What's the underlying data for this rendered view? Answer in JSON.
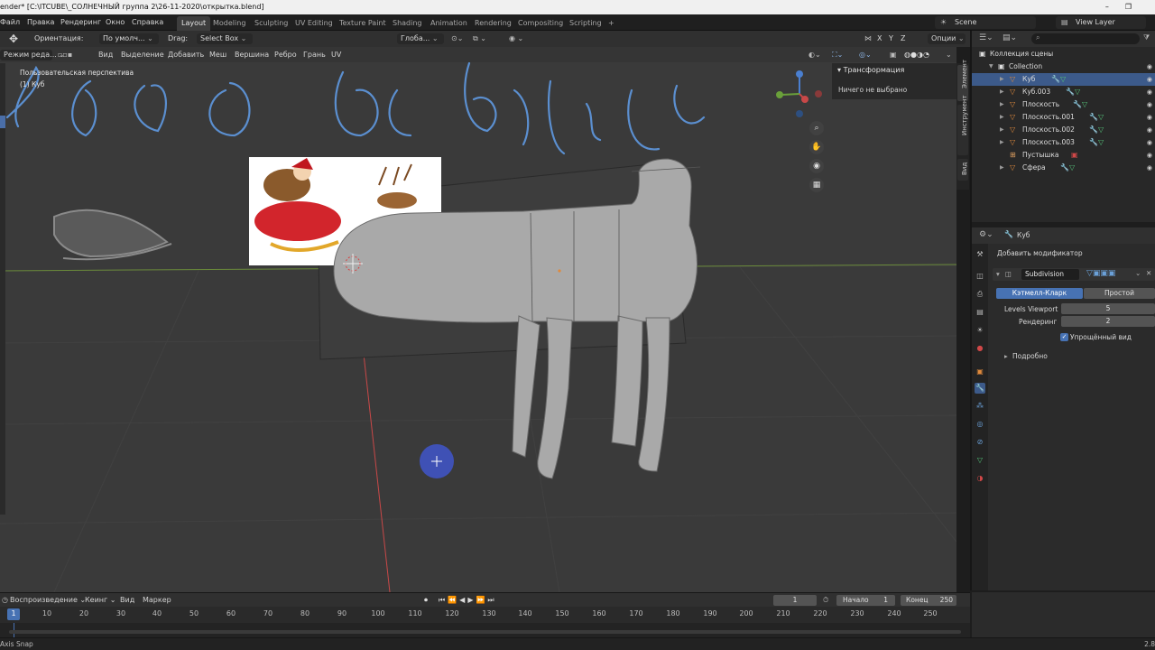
{
  "window": {
    "title": "ender* [C:\\ITCUBE\\_СОЛНЕЧНЫЙ группа 2\\26-11-2020\\открытка.blend]",
    "restore_icon": "restore-icon"
  },
  "menubar": {
    "menus": [
      "Файл",
      "Правка",
      "Рендеринг",
      "Окно",
      "Справка"
    ],
    "workspaces": [
      "Layout",
      "Modeling",
      "Sculpting",
      "UV Editing",
      "Texture Paint",
      "Shading",
      "Animation",
      "Rendering",
      "Compositing",
      "Scripting"
    ],
    "active_workspace": "Layout",
    "add_tab": "+",
    "scene": "Scene",
    "view_layer": "View Layer"
  },
  "tool_header": {
    "orientation_label": "Ориентация:",
    "orientation_value": "По умолч...",
    "drag_label": "Drag:",
    "drag_value": "Select Box",
    "transform_value": "Глоба...",
    "axes": [
      "X",
      "Y",
      "Z"
    ],
    "options": "Опции"
  },
  "viewport_header": {
    "mode": "Режим реда...",
    "menus": [
      "Вид",
      "Выделение",
      "Добавить",
      "Меш",
      "Вершина",
      "Ребро",
      "Грань",
      "UV"
    ]
  },
  "viewport": {
    "perspective": "Пользовательская перспектива",
    "object": "(1) Куб",
    "handwriting": "Ξ ǝǝɡ ǝo ǝκςrpt",
    "colors": {
      "background": "#3a3a3a",
      "mesh": "#a9a9a9",
      "handwriting": "#5b8fd0",
      "cursor_circle": "#3f51b5",
      "x_axis": "#c84848"
    }
  },
  "n_panel": {
    "header": "Трансформация",
    "message": "Ничего не выбрано",
    "tabs": [
      "Элемент",
      "Инструмент",
      "Вид"
    ]
  },
  "outliner": {
    "header": "Коллекция сцены",
    "collection": "Collection",
    "items": [
      {
        "name": "Куб",
        "selected": true
      },
      {
        "name": "Куб.003",
        "selected": false
      },
      {
        "name": "Плоскость",
        "selected": false
      },
      {
        "name": "Плоскость.001",
        "selected": false
      },
      {
        "name": "Плоскость.002",
        "selected": false
      },
      {
        "name": "Плоскость.003",
        "selected": false
      },
      {
        "name": "Пустышка",
        "selected": false
      },
      {
        "name": "Сфера",
        "selected": false
      }
    ]
  },
  "properties": {
    "object": "Куб",
    "add_modifier": "Добавить модификатор",
    "modifier_name": "Subdivision",
    "mode_catmull": "Кэтмелл-Кларк",
    "mode_simple": "Простой",
    "levels_viewport_label": "Levels Viewport",
    "levels_viewport_value": "5",
    "render_label": "Рендеринг",
    "render_value": "2",
    "optimal_display": "Упрощённый вид",
    "advanced": "Подробно"
  },
  "timeline": {
    "menus": [
      "Воспроизведение",
      "Кеинг",
      "Вид",
      "Маркер"
    ],
    "current_frame": "1",
    "start_label": "Начало",
    "start_value": "1",
    "end_label": "Конец",
    "end_value": "250",
    "ticks": [
      "1",
      "10",
      "20",
      "30",
      "40",
      "50",
      "60",
      "70",
      "80",
      "90",
      "100",
      "110",
      "120",
      "130",
      "140",
      "150",
      "160",
      "170",
      "180",
      "190",
      "200",
      "210",
      "220",
      "230",
      "240",
      "250"
    ]
  },
  "statusbar": {
    "left": "Axis Snap",
    "right": "2.8"
  }
}
